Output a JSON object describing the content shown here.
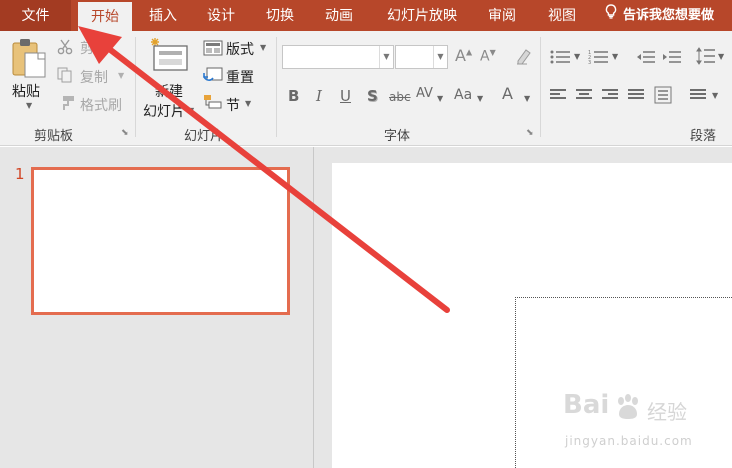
{
  "tabs": [
    {
      "label": "文件"
    },
    {
      "label": "开始"
    },
    {
      "label": "插入"
    },
    {
      "label": "设计"
    },
    {
      "label": "切换"
    },
    {
      "label": "动画"
    },
    {
      "label": "幻灯片放映"
    },
    {
      "label": "审阅"
    },
    {
      "label": "视图"
    }
  ],
  "tell_me": {
    "label": "告诉我您想要做",
    "icon": "lightbulb-icon"
  },
  "clipboard": {
    "paste_label": "粘贴",
    "cut_label": "剪切",
    "copy_label": "复制",
    "format_painter_label": "格式刷",
    "group_label": "剪贴板"
  },
  "slides_group": {
    "new_slide_line1": "新建",
    "new_slide_line2": "幻灯片",
    "layout_label": "版式",
    "reset_label": "重置",
    "section_label": "节",
    "group_label": "幻灯片"
  },
  "font_group": {
    "font_name_value": "",
    "font_size_value": "",
    "group_label": "字体",
    "buttons": {
      "bold": "B",
      "italic": "I",
      "underline": "U",
      "shadow": "S",
      "strike": "abc",
      "spacing": "AV",
      "case": "Aa",
      "color": "A"
    }
  },
  "paragraph_group": {
    "group_label": "段落"
  },
  "thumbnails": [
    {
      "number": "1"
    }
  ],
  "watermark": {
    "logo": "Bai",
    "text": "经验",
    "url": "jingyan.baidu.com"
  },
  "colors": {
    "accent": "#b7472a",
    "file_tab": "#a33b22",
    "ribbon": "#f1f1f1",
    "thumb_border": "#e46c4f",
    "arrow": "#e8413b"
  }
}
